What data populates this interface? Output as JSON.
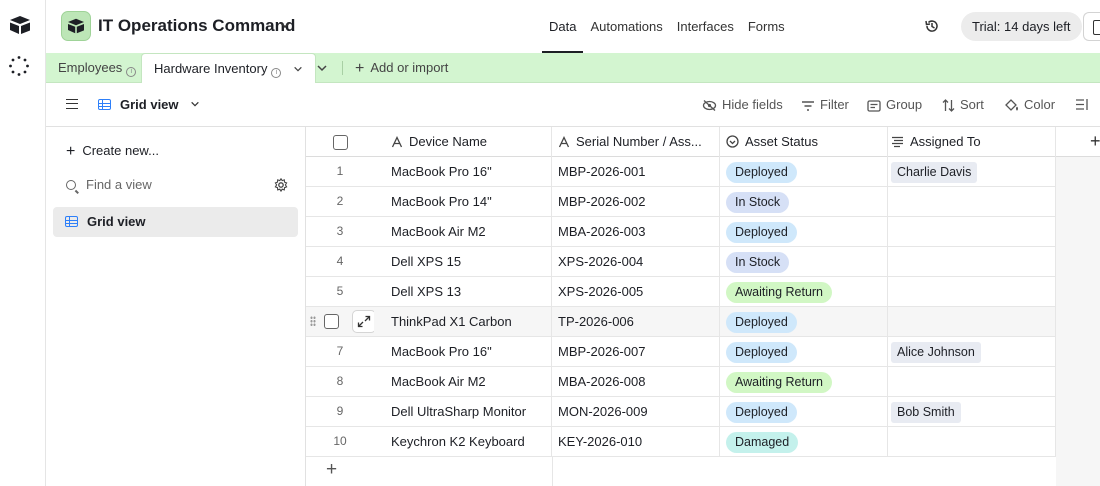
{
  "app": {
    "base_title": "IT Operations Command",
    "top_nav": [
      "Data",
      "Automations",
      "Interfaces",
      "Forms"
    ],
    "active_nav": "Data",
    "trial_label": "Trial: 14 days left"
  },
  "tables": {
    "tabs": [
      "Employees",
      "Hardware Inventory"
    ],
    "active": "Hardware Inventory",
    "add_label": "Add or import"
  },
  "toolbar": {
    "view_name": "Grid view",
    "hide_fields": "Hide fields",
    "filter": "Filter",
    "group": "Group",
    "sort": "Sort",
    "color": "Color"
  },
  "sidebar": {
    "create_new": "Create new...",
    "find_placeholder": "Find a view",
    "views": [
      "Grid view"
    ]
  },
  "grid": {
    "columns": [
      "Device Name",
      "Serial Number / Ass...",
      "Asset Status",
      "Assigned To"
    ],
    "rows": [
      {
        "num": "1",
        "device": "MacBook Pro 16\"",
        "serial": "MBP-2026-001",
        "status": "Deployed",
        "assigned": "Charlie Davis"
      },
      {
        "num": "2",
        "device": "MacBook Pro 14\"",
        "serial": "MBP-2026-002",
        "status": "In Stock",
        "assigned": ""
      },
      {
        "num": "3",
        "device": "MacBook Air M2",
        "serial": "MBA-2026-003",
        "status": "Deployed",
        "assigned": ""
      },
      {
        "num": "4",
        "device": "Dell XPS 15",
        "serial": "XPS-2026-004",
        "status": "In Stock",
        "assigned": ""
      },
      {
        "num": "5",
        "device": "Dell XPS 13",
        "serial": "XPS-2026-005",
        "status": "Awaiting Return",
        "assigned": ""
      },
      {
        "num": "",
        "device": "ThinkPad X1 Carbon",
        "serial": "TP-2026-006",
        "status": "Deployed",
        "assigned": ""
      },
      {
        "num": "7",
        "device": "MacBook Pro 16\"",
        "serial": "MBP-2026-007",
        "status": "Deployed",
        "assigned": "Alice Johnson"
      },
      {
        "num": "8",
        "device": "MacBook Air M2",
        "serial": "MBA-2026-008",
        "status": "Awaiting Return",
        "assigned": ""
      },
      {
        "num": "9",
        "device": "Dell UltraSharp Monitor",
        "serial": "MON-2026-009",
        "status": "Deployed",
        "assigned": "Bob Smith"
      },
      {
        "num": "10",
        "device": "Keychron K2 Keyboard",
        "serial": "KEY-2026-010",
        "status": "Damaged",
        "assigned": ""
      }
    ]
  },
  "colors": {
    "accent": "#2d7ff9",
    "tables_bar": "#d3f5d0",
    "base_icon": "#bde6b7",
    "status_deployed": "#cfe8fb",
    "status_in_stock": "#d6e0f6",
    "status_awaiting_return": "#d1f7c4",
    "status_damaged": "#c4f1ec"
  }
}
